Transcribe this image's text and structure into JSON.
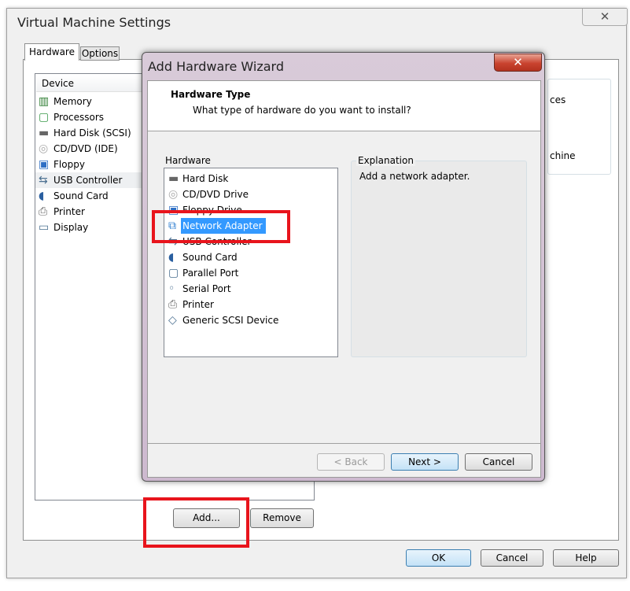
{
  "main_window": {
    "title": "Virtual Machine Settings",
    "close_icon": "close-icon",
    "tabs": [
      {
        "label": "Hardware",
        "active": true
      },
      {
        "label": "Options",
        "active": false
      }
    ],
    "device_header": "Device",
    "devices": [
      {
        "label": "Memory",
        "icon": "memory-icon"
      },
      {
        "label": "Processors",
        "icon": "processor-icon"
      },
      {
        "label": "Hard Disk (SCSI)",
        "icon": "hard-disk-icon"
      },
      {
        "label": "CD/DVD (IDE)",
        "icon": "cd-dvd-icon"
      },
      {
        "label": "Floppy",
        "icon": "floppy-icon"
      },
      {
        "label": "USB Controller",
        "icon": "usb-icon",
        "selected": true
      },
      {
        "label": "Sound Card",
        "icon": "sound-icon"
      },
      {
        "label": "Printer",
        "icon": "printer-icon"
      },
      {
        "label": "Display",
        "icon": "display-icon"
      }
    ],
    "right_partial": {
      "line1": "ces",
      "line2": "chine"
    },
    "add_button": "Add...",
    "remove_button": "Remove",
    "ok_button": "OK",
    "cancel_button": "Cancel",
    "help_button": "Help"
  },
  "wizard": {
    "title": "Add Hardware Wizard",
    "heading": "Hardware Type",
    "subheading": "What type of hardware do you want to install?",
    "hardware_label": "Hardware",
    "hardware_items": [
      {
        "label": "Hard Disk",
        "icon": "hard-disk-icon"
      },
      {
        "label": "CD/DVD Drive",
        "icon": "cd-dvd-icon"
      },
      {
        "label": "Floppy Drive",
        "icon": "floppy-icon"
      },
      {
        "label": "Network Adapter",
        "icon": "network-icon",
        "selected": true
      },
      {
        "label": "USB Controller",
        "icon": "usb-icon"
      },
      {
        "label": "Sound Card",
        "icon": "sound-icon"
      },
      {
        "label": "Parallel Port",
        "icon": "parallel-port-icon"
      },
      {
        "label": "Serial Port",
        "icon": "serial-port-icon"
      },
      {
        "label": "Printer",
        "icon": "printer-icon"
      },
      {
        "label": "Generic SCSI Device",
        "icon": "scsi-icon"
      }
    ],
    "explanation_label": "Explanation",
    "explanation_text": "Add a network adapter.",
    "back_button": "< Back",
    "next_button": "Next >",
    "cancel_button": "Cancel"
  },
  "colors": {
    "selection": "#3399ff",
    "highlight_box": "#e8141c",
    "close_button": "#c9432f"
  }
}
